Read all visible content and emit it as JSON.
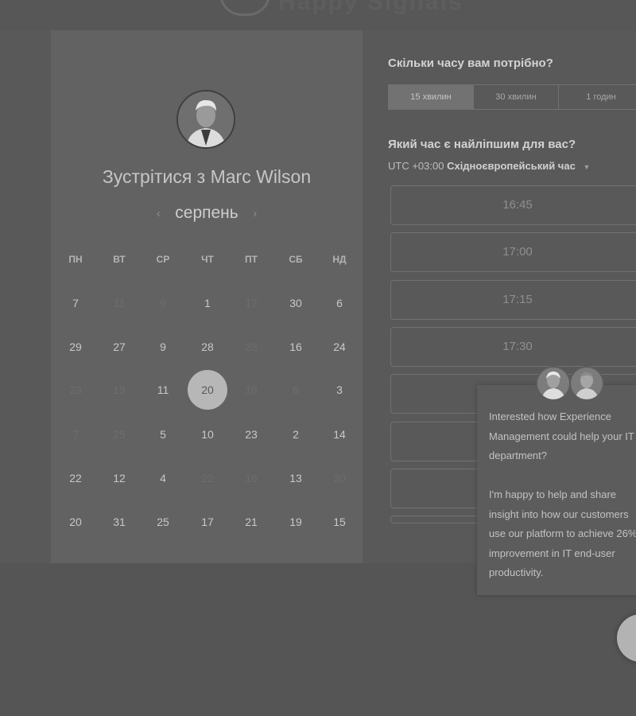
{
  "header": {
    "logo_text": "Happy Signals"
  },
  "host": {
    "meet_title": "Зустрітися з Marc Wilson"
  },
  "calendar": {
    "month": "серпень",
    "weekdays": [
      "ПН",
      "ВТ",
      "СР",
      "ЧТ",
      "ПТ",
      "СБ",
      "НД"
    ],
    "weeks": [
      [
        {
          "d": "7",
          "a": true
        },
        {
          "d": "11",
          "a": false
        },
        {
          "d": "9",
          "a": false
        },
        {
          "d": "1",
          "a": true
        },
        {
          "d": "17",
          "a": false
        },
        {
          "d": "30",
          "a": true
        },
        {
          "d": "6",
          "a": true
        }
      ],
      [
        {
          "d": "29",
          "a": true
        },
        {
          "d": "27",
          "a": true
        },
        {
          "d": "9",
          "a": true
        },
        {
          "d": "28",
          "a": true
        },
        {
          "d": "23",
          "a": false
        },
        {
          "d": "16",
          "a": true
        },
        {
          "d": "24",
          "a": true
        }
      ],
      [
        {
          "d": "23",
          "a": false
        },
        {
          "d": "19",
          "a": false
        },
        {
          "d": "11",
          "a": true
        },
        {
          "d": "20",
          "a": true,
          "selected": true
        },
        {
          "d": "18",
          "a": false
        },
        {
          "d": "6",
          "a": false
        },
        {
          "d": "3",
          "a": true
        }
      ],
      [
        {
          "d": "7",
          "a": false
        },
        {
          "d": "25",
          "a": false
        },
        {
          "d": "5",
          "a": true
        },
        {
          "d": "10",
          "a": true
        },
        {
          "d": "23",
          "a": true
        },
        {
          "d": "2",
          "a": true
        },
        {
          "d": "14",
          "a": true
        }
      ],
      [
        {
          "d": "22",
          "a": true
        },
        {
          "d": "12",
          "a": true
        },
        {
          "d": "4",
          "a": true
        },
        {
          "d": "22",
          "a": false
        },
        {
          "d": "16",
          "a": false
        },
        {
          "d": "13",
          "a": true
        },
        {
          "d": "30",
          "a": false
        }
      ],
      [
        {
          "d": "20",
          "a": true
        },
        {
          "d": "31",
          "a": true
        },
        {
          "d": "25",
          "a": true
        },
        {
          "d": "17",
          "a": true
        },
        {
          "d": "21",
          "a": true
        },
        {
          "d": "19",
          "a": true
        },
        {
          "d": "15",
          "a": true
        }
      ]
    ]
  },
  "booking": {
    "duration_question": "Скільки часу вам потрібно?",
    "durations": [
      "15 хвилин",
      "30 хвилин",
      "1 годин"
    ],
    "time_question": "Який час є найліпшим для вас?",
    "timezone_offset": "UTC +03:00",
    "timezone_name": "Східноєвропейський час",
    "slots": [
      "16:45",
      "17:00",
      "17:15",
      "17:30",
      "",
      "",
      "",
      ""
    ]
  },
  "chat": {
    "message": "Interested how Experience Management could help your IT department?\n\nI'm happy to help and share insight into how our customers use our platform to achieve 26% improvement in IT end-user productivity."
  }
}
